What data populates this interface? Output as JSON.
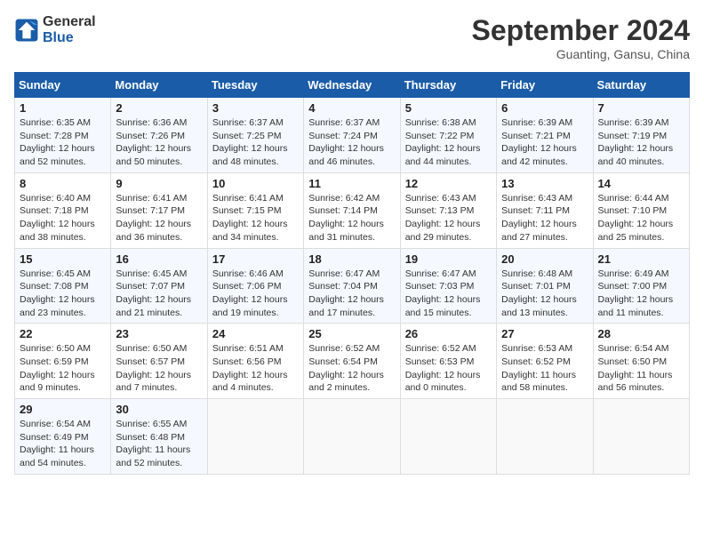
{
  "header": {
    "logo_line1": "General",
    "logo_line2": "Blue",
    "month": "September 2024",
    "location": "Guanting, Gansu, China"
  },
  "weekdays": [
    "Sunday",
    "Monday",
    "Tuesday",
    "Wednesday",
    "Thursday",
    "Friday",
    "Saturday"
  ],
  "weeks": [
    [
      {
        "day": "1",
        "info": "Sunrise: 6:35 AM\nSunset: 7:28 PM\nDaylight: 12 hours\nand 52 minutes."
      },
      {
        "day": "2",
        "info": "Sunrise: 6:36 AM\nSunset: 7:26 PM\nDaylight: 12 hours\nand 50 minutes."
      },
      {
        "day": "3",
        "info": "Sunrise: 6:37 AM\nSunset: 7:25 PM\nDaylight: 12 hours\nand 48 minutes."
      },
      {
        "day": "4",
        "info": "Sunrise: 6:37 AM\nSunset: 7:24 PM\nDaylight: 12 hours\nand 46 minutes."
      },
      {
        "day": "5",
        "info": "Sunrise: 6:38 AM\nSunset: 7:22 PM\nDaylight: 12 hours\nand 44 minutes."
      },
      {
        "day": "6",
        "info": "Sunrise: 6:39 AM\nSunset: 7:21 PM\nDaylight: 12 hours\nand 42 minutes."
      },
      {
        "day": "7",
        "info": "Sunrise: 6:39 AM\nSunset: 7:19 PM\nDaylight: 12 hours\nand 40 minutes."
      }
    ],
    [
      {
        "day": "8",
        "info": "Sunrise: 6:40 AM\nSunset: 7:18 PM\nDaylight: 12 hours\nand 38 minutes."
      },
      {
        "day": "9",
        "info": "Sunrise: 6:41 AM\nSunset: 7:17 PM\nDaylight: 12 hours\nand 36 minutes."
      },
      {
        "day": "10",
        "info": "Sunrise: 6:41 AM\nSunset: 7:15 PM\nDaylight: 12 hours\nand 34 minutes."
      },
      {
        "day": "11",
        "info": "Sunrise: 6:42 AM\nSunset: 7:14 PM\nDaylight: 12 hours\nand 31 minutes."
      },
      {
        "day": "12",
        "info": "Sunrise: 6:43 AM\nSunset: 7:13 PM\nDaylight: 12 hours\nand 29 minutes."
      },
      {
        "day": "13",
        "info": "Sunrise: 6:43 AM\nSunset: 7:11 PM\nDaylight: 12 hours\nand 27 minutes."
      },
      {
        "day": "14",
        "info": "Sunrise: 6:44 AM\nSunset: 7:10 PM\nDaylight: 12 hours\nand 25 minutes."
      }
    ],
    [
      {
        "day": "15",
        "info": "Sunrise: 6:45 AM\nSunset: 7:08 PM\nDaylight: 12 hours\nand 23 minutes."
      },
      {
        "day": "16",
        "info": "Sunrise: 6:45 AM\nSunset: 7:07 PM\nDaylight: 12 hours\nand 21 minutes."
      },
      {
        "day": "17",
        "info": "Sunrise: 6:46 AM\nSunset: 7:06 PM\nDaylight: 12 hours\nand 19 minutes."
      },
      {
        "day": "18",
        "info": "Sunrise: 6:47 AM\nSunset: 7:04 PM\nDaylight: 12 hours\nand 17 minutes."
      },
      {
        "day": "19",
        "info": "Sunrise: 6:47 AM\nSunset: 7:03 PM\nDaylight: 12 hours\nand 15 minutes."
      },
      {
        "day": "20",
        "info": "Sunrise: 6:48 AM\nSunset: 7:01 PM\nDaylight: 12 hours\nand 13 minutes."
      },
      {
        "day": "21",
        "info": "Sunrise: 6:49 AM\nSunset: 7:00 PM\nDaylight: 12 hours\nand 11 minutes."
      }
    ],
    [
      {
        "day": "22",
        "info": "Sunrise: 6:50 AM\nSunset: 6:59 PM\nDaylight: 12 hours\nand 9 minutes."
      },
      {
        "day": "23",
        "info": "Sunrise: 6:50 AM\nSunset: 6:57 PM\nDaylight: 12 hours\nand 7 minutes."
      },
      {
        "day": "24",
        "info": "Sunrise: 6:51 AM\nSunset: 6:56 PM\nDaylight: 12 hours\nand 4 minutes."
      },
      {
        "day": "25",
        "info": "Sunrise: 6:52 AM\nSunset: 6:54 PM\nDaylight: 12 hours\nand 2 minutes."
      },
      {
        "day": "26",
        "info": "Sunrise: 6:52 AM\nSunset: 6:53 PM\nDaylight: 12 hours\nand 0 minutes."
      },
      {
        "day": "27",
        "info": "Sunrise: 6:53 AM\nSunset: 6:52 PM\nDaylight: 11 hours\nand 58 minutes."
      },
      {
        "day": "28",
        "info": "Sunrise: 6:54 AM\nSunset: 6:50 PM\nDaylight: 11 hours\nand 56 minutes."
      }
    ],
    [
      {
        "day": "29",
        "info": "Sunrise: 6:54 AM\nSunset: 6:49 PM\nDaylight: 11 hours\nand 54 minutes."
      },
      {
        "day": "30",
        "info": "Sunrise: 6:55 AM\nSunset: 6:48 PM\nDaylight: 11 hours\nand 52 minutes."
      },
      {
        "day": "",
        "info": ""
      },
      {
        "day": "",
        "info": ""
      },
      {
        "day": "",
        "info": ""
      },
      {
        "day": "",
        "info": ""
      },
      {
        "day": "",
        "info": ""
      }
    ]
  ]
}
